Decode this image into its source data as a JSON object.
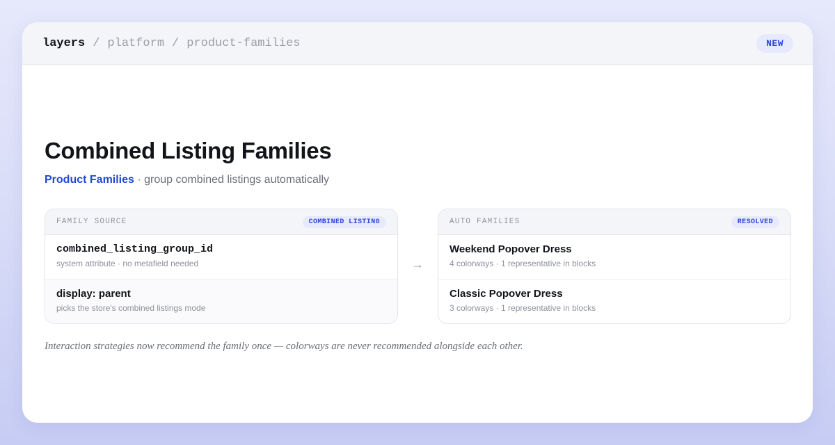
{
  "breadcrumb": {
    "root": "layers",
    "separator": "/",
    "items": [
      "platform",
      "product-families"
    ]
  },
  "badge": "NEW",
  "page": {
    "title": "Combined Listing Families",
    "subtitle_brand": "Product Families",
    "subtitle_rest": " · group combined listings automatically"
  },
  "family_source": {
    "label": "FAMILY SOURCE",
    "chip": "COMBINED LISTING",
    "rows": [
      {
        "title": "combined_listing_group_id",
        "sub": "system attribute · no metafield needed"
      },
      {
        "title": "display: parent",
        "sub": "picks the store's combined listings mode"
      }
    ]
  },
  "arrow": "→",
  "auto_families": {
    "label": "AUTO FAMILIES",
    "chip": "RESOLVED",
    "rows": [
      {
        "title": "Weekend Popover Dress",
        "sub": "4 colorways · 1 representative in blocks"
      },
      {
        "title": "Classic Popover Dress",
        "sub": "3 colorways · 1 representative in blocks"
      }
    ]
  },
  "footnote": "Interaction strategies now recommend the family once — colorways are never recommended alongside each other.",
  "colors": {
    "accent": "#2147d6",
    "badge_bg": "#e6eafc",
    "background_top": "#e6e8fb",
    "background_bottom": "#c6ccf4"
  }
}
